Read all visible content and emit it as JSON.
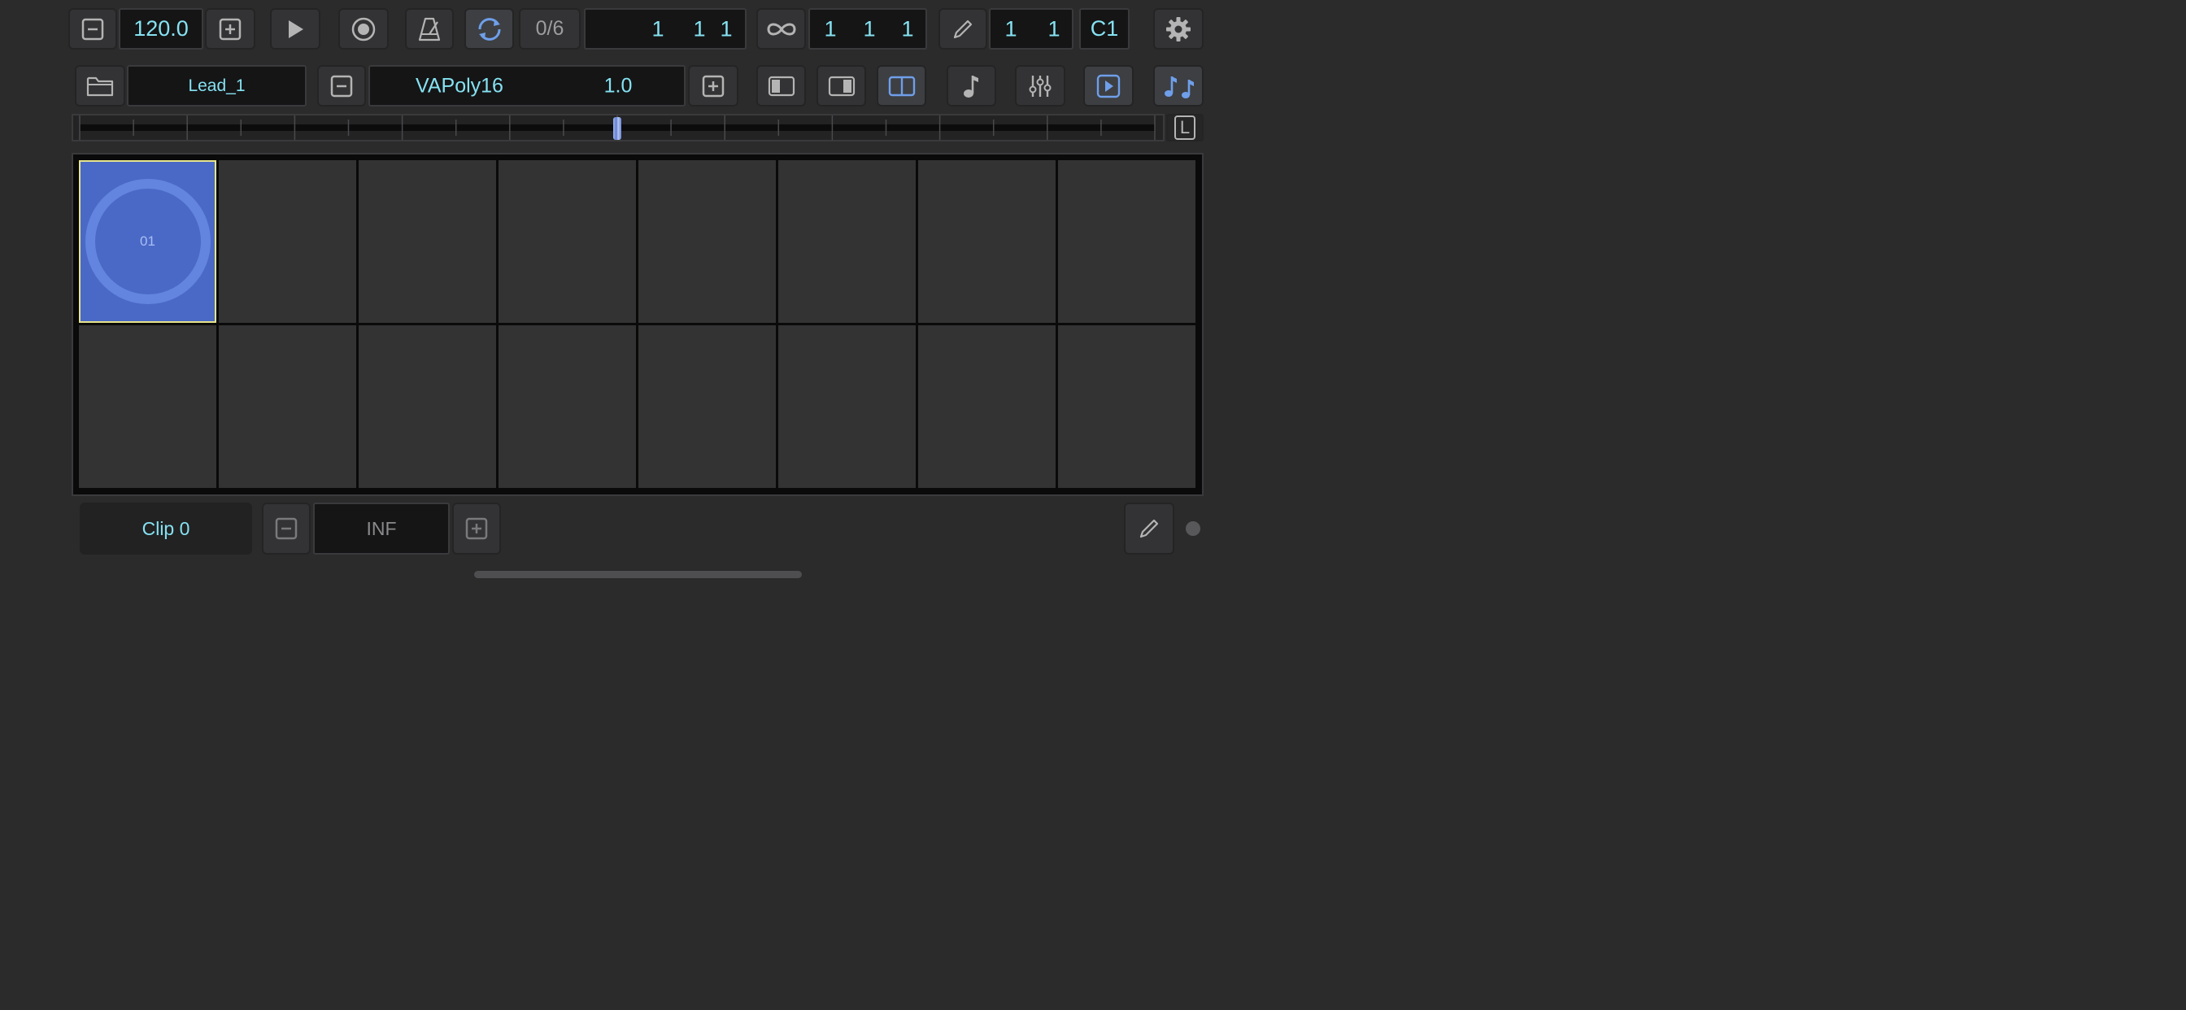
{
  "transport": {
    "tempo": "120.0",
    "loop_count": "0/6",
    "position": [
      "1",
      "1",
      "1"
    ],
    "loop_length": [
      "1",
      "1",
      "1"
    ],
    "edit_grid": [
      "1",
      "1"
    ],
    "root_note": "C1"
  },
  "instrument": {
    "preset_name": "Lead_1",
    "synth_name": "VAPoly16",
    "synth_value": "1.0"
  },
  "scrubber": {
    "lock_label": "L",
    "position_fraction": 0.5
  },
  "pads": {
    "selected_label": "01"
  },
  "clip": {
    "name": "Clip 0",
    "repeat_value": "INF"
  },
  "colors": {
    "accent": "#86e2f2",
    "active_icon": "#6f9fea",
    "selected_pad": "#4a69c6",
    "pad_ring": "#6384df",
    "pad_border": "#e6e48a"
  }
}
